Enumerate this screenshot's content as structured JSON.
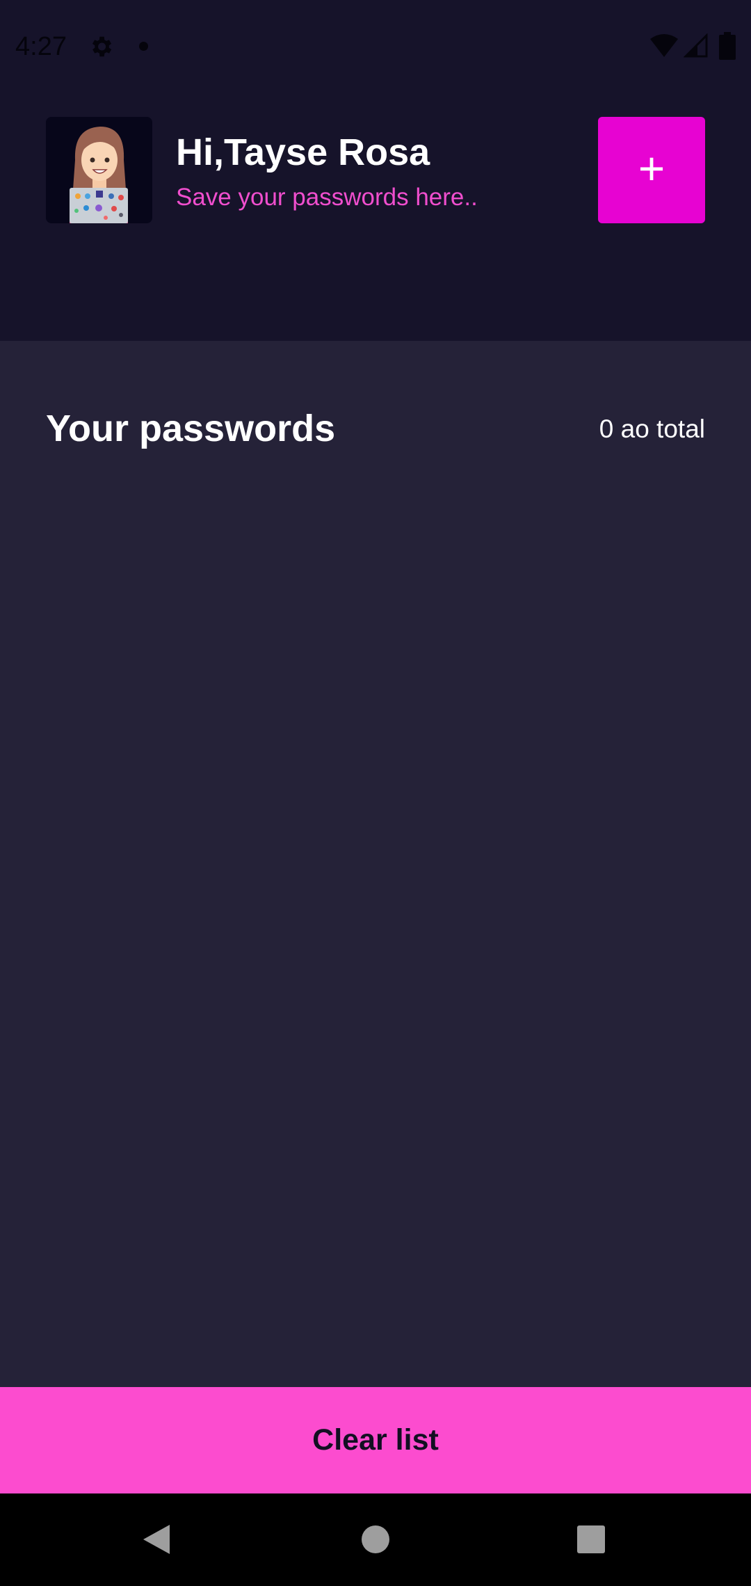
{
  "status_bar": {
    "time": "4:27",
    "icons": [
      "gear-icon",
      "notification-dot-icon",
      "wifi-icon",
      "cell-signal-icon",
      "battery-icon"
    ]
  },
  "header": {
    "greeting": "Hi,Tayse Rosa",
    "subtitle": "Save your passwords here..",
    "avatar_icon": "woman-with-laptop-avatar",
    "add_button_label": "+"
  },
  "passwords": {
    "title": "Your passwords",
    "count_label": "0 ao total",
    "items": []
  },
  "footer": {
    "clear_button_label": "Clear list"
  },
  "nav_bar": {
    "icons": [
      "back-icon",
      "home-icon",
      "recents-icon"
    ]
  },
  "colors": {
    "header_bg": "#16132a",
    "content_bg": "#252238",
    "accent_magenta": "#e703d2",
    "accent_pink": "#fc4ccf",
    "subtitle_pink": "#f04ece"
  }
}
